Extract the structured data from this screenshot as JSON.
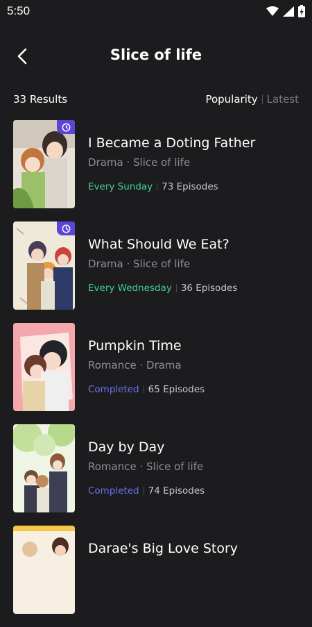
{
  "status_bar": {
    "time": "5:50"
  },
  "header": {
    "title": "Slice of life"
  },
  "results": {
    "count_label": "33 Results",
    "sort_options": [
      "Popularity",
      "Latest"
    ],
    "active_sort": "Popularity"
  },
  "colors": {
    "weekly_schedule": "#3fcf9a",
    "completed": "#6a6ff0",
    "badge": "#5b44d6"
  },
  "items": [
    {
      "title": "I Became a Doting Father",
      "genres": "Drama · Slice of life",
      "status": "Every Sunday",
      "episodes": "73 Episodes",
      "status_type": "weekly",
      "badge": "clock-icon"
    },
    {
      "title": "What Should We Eat?",
      "genres": "Drama · Slice of life",
      "status": "Every Wednesday",
      "episodes": "36 Episodes",
      "status_type": "weekly",
      "badge": "clock-icon"
    },
    {
      "title": "Pumpkin Time",
      "genres": "Romance · Drama",
      "status": "Completed",
      "episodes": "65 Episodes",
      "status_type": "completed"
    },
    {
      "title": "Day by Day",
      "genres": "Romance · Slice of life",
      "status": "Completed",
      "episodes": "74 Episodes",
      "status_type": "completed"
    },
    {
      "title": "Darae's Big Love Story"
    }
  ]
}
